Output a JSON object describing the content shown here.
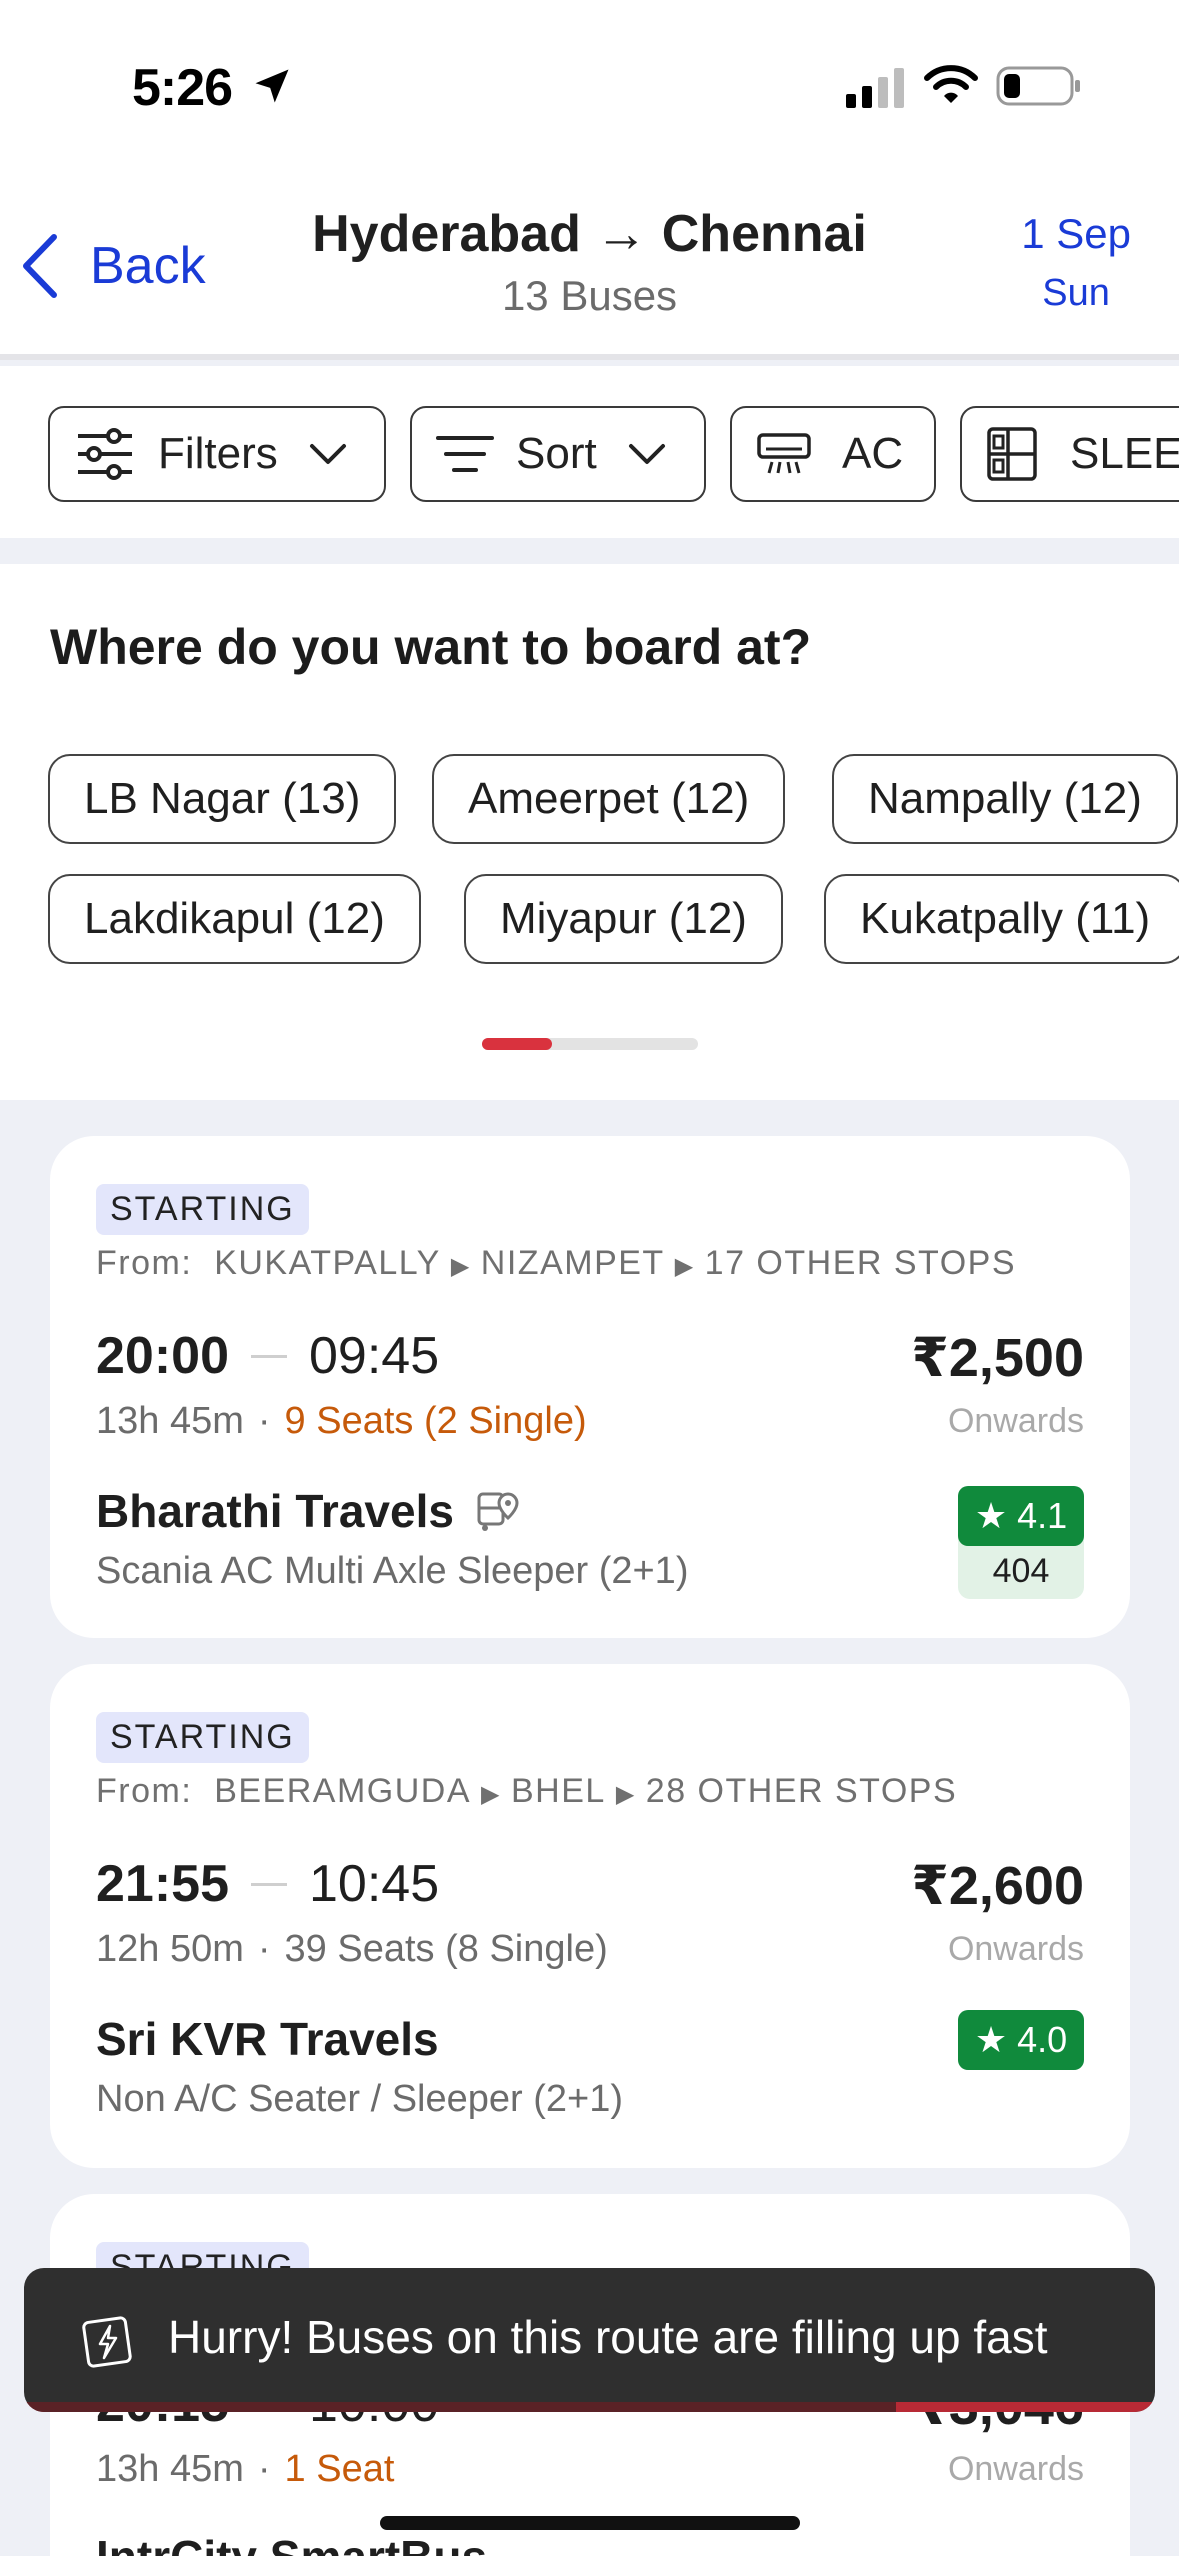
{
  "status_bar": {
    "time": "5:26"
  },
  "header": {
    "back_label": "Back",
    "route": "Hyderabad → Chennai",
    "bus_count": "13 Buses",
    "date": "1 Sep",
    "day": "Sun"
  },
  "filters": {
    "filters_label": "Filters",
    "sort_label": "Sort",
    "ac_label": "AC",
    "sleeper_label": "SLEEPER"
  },
  "boarding": {
    "title": "Where do you want to board at?",
    "points": [
      "LB Nagar (13)",
      "Ameerpet (12)",
      "Nampally (12)",
      "Lakdikapul (12)",
      "Miyapur (12)",
      "Kukatpally (11)"
    ]
  },
  "buses": [
    {
      "tag": "STARTING",
      "from_label": "From:",
      "stops": [
        "KUKATPALLY",
        "NIZAMPET",
        "17 OTHER STOPS"
      ],
      "departure": "20:00",
      "arrival": "09:45",
      "duration": "13h 45m",
      "seats": "9 Seats",
      "single": "(2 Single)",
      "price": "₹2,500",
      "onwards": "Onwards",
      "operator": "Bharathi  Travels",
      "bus_type": "Scania AC Multi Axle Sleeper (2+1)",
      "rating": "★ 4.1",
      "rating_count": "404"
    },
    {
      "tag": "STARTING",
      "from_label": "From:",
      "stops": [
        "BEERAMGUDA",
        "BHEL",
        "28 OTHER STOPS"
      ],
      "departure": "21:55",
      "arrival": "10:45",
      "duration": "12h 50m",
      "seats": "39 Seats",
      "single": "(8 Single)",
      "price": "₹2,600",
      "onwards": "Onwards",
      "operator": "Sri KVR Travels",
      "bus_type": "Non A/C Seater / Sleeper (2+1)",
      "rating": "★ 4.0"
    },
    {
      "tag": "STARTING",
      "departure": "20:15",
      "arrival": "10:00",
      "duration": "13h 45m",
      "seats": "1 Seat",
      "price": "₹3,046",
      "onwards": "Onwards",
      "operator": "IntrCity SmartBus"
    }
  ],
  "toast": {
    "message": "Hurry! Buses on this route are filling up fast"
  },
  "colors": {
    "link_blue": "#1a3bd6",
    "rating_green": "#108a3c",
    "accent_red": "#d9323e",
    "seats_orange": "#c65a0a"
  }
}
